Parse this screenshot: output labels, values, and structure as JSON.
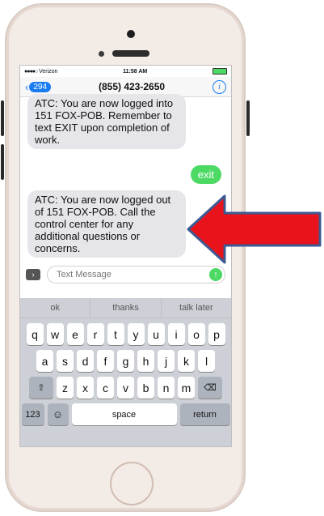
{
  "status": {
    "carrier": "Verizon",
    "signal": "●●●●○",
    "time": "11:58 AM",
    "battery": "▬"
  },
  "nav": {
    "back_count": "294",
    "title": "(855) 423-2650",
    "info": "i"
  },
  "messages": {
    "m1": "ATC: You are now logged into 151  FOX-POB. Remember to text EXIT upon completion of work.",
    "m2": "exit",
    "m3": "ATC: You are now logged out of 151  FOX-POB. Call the control center for any additional questions or concerns."
  },
  "composer": {
    "placeholder": "Text Message"
  },
  "keyboard": {
    "predictions": [
      "ok",
      "thanks",
      "talk later"
    ],
    "row1": [
      "q",
      "w",
      "e",
      "r",
      "t",
      "y",
      "u",
      "i",
      "o",
      "p"
    ],
    "row2": [
      "a",
      "s",
      "d",
      "f",
      "g",
      "h",
      "j",
      "k",
      "l"
    ],
    "row3": [
      "z",
      "x",
      "c",
      "v",
      "b",
      "n",
      "m"
    ],
    "num": "123",
    "space": "space",
    "return": "return"
  },
  "colors": {
    "accent": "#1b7cf2",
    "sent": "#4cd964",
    "arrow": "#e8131b",
    "arrow_outline": "#3d5a93"
  }
}
